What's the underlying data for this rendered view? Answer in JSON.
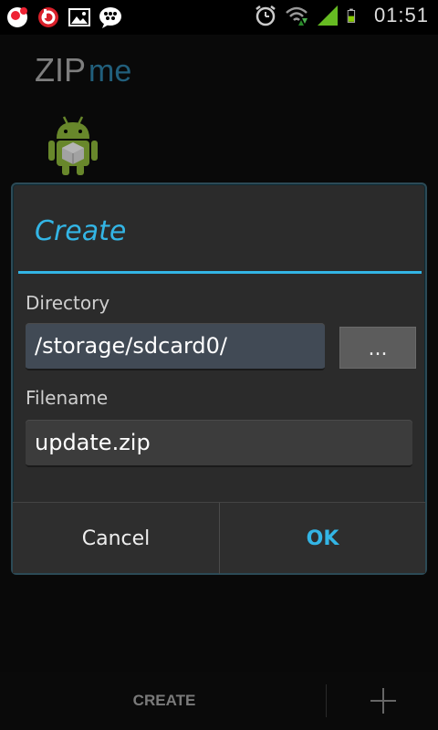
{
  "status_bar": {
    "time": "01:51",
    "icons": [
      "notification-flower-icon",
      "beats-icon",
      "gallery-icon",
      "bbm-icon",
      "alarm-icon",
      "wifi-icon",
      "signal-icon",
      "battery-icon"
    ]
  },
  "app": {
    "logo_zip": "ZIP",
    "logo_me": "me"
  },
  "dialog": {
    "title": "Create",
    "directory_label": "Directory",
    "directory_value": "/storage/sdcard0/",
    "browse_label": "...",
    "filename_label": "Filename",
    "filename_value": "update.zip",
    "cancel_label": "Cancel",
    "ok_label": "OK"
  },
  "bottom_bar": {
    "create_label": "CREATE"
  },
  "colors": {
    "accent": "#33b5e5",
    "logo_me": "#2d7fa6",
    "android_green": "#8bb43a"
  }
}
